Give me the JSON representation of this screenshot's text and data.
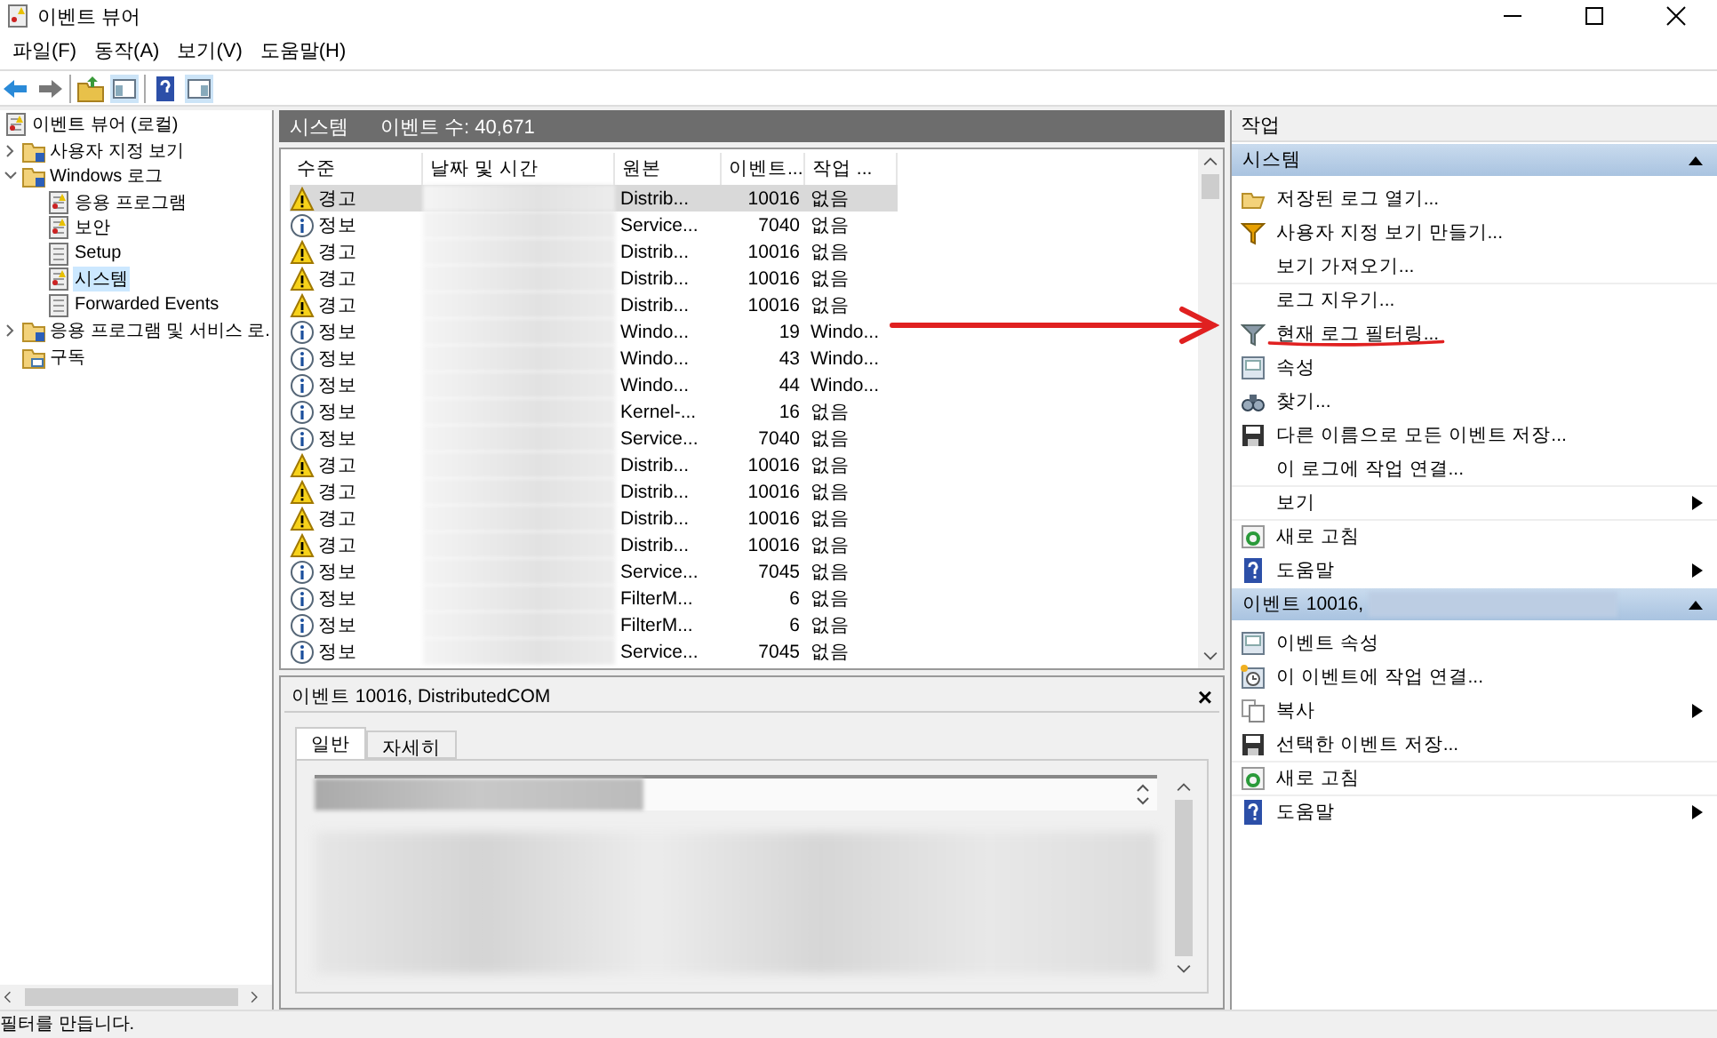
{
  "window": {
    "title": "이벤트 뷰어"
  },
  "menu": [
    "파일(F)",
    "동작(A)",
    "보기(V)",
    "도움말(H)"
  ],
  "tree": [
    {
      "label": "이벤트 뷰어 (로컬)",
      "kind": "root",
      "selected": false,
      "children": [
        {
          "label": "사용자 지정 보기",
          "kind": "folder",
          "selected": false,
          "expanded": false
        },
        {
          "label": "Windows 로그",
          "kind": "folder",
          "selected": false,
          "expanded": true,
          "children": [
            {
              "label": "응용 프로그램",
              "kind": "log",
              "selected": false
            },
            {
              "label": "보안",
              "kind": "log",
              "selected": false
            },
            {
              "label": "Setup",
              "kind": "plain",
              "selected": false
            },
            {
              "label": "시스템",
              "kind": "log",
              "selected": true
            },
            {
              "label": "Forwarded Events",
              "kind": "plain",
              "selected": false
            }
          ]
        },
        {
          "label": "응용 프로그램 및 서비스 로.",
          "kind": "folder",
          "selected": false,
          "expanded": false
        },
        {
          "label": "구독",
          "kind": "subscription",
          "selected": false
        }
      ]
    }
  ],
  "list": {
    "title": "시스템",
    "count": "이벤트 수: 40,671",
    "columns": [
      "수준",
      "날짜 및 시간",
      "원본",
      "이벤트...",
      "작업 ..."
    ],
    "rows": [
      {
        "kind": "warning",
        "level": "경고",
        "source": "Distrib...",
        "id": "10016",
        "category": "없음",
        "selected": true
      },
      {
        "kind": "info",
        "level": "정보",
        "source": "Service...",
        "id": "7040",
        "category": "없음",
        "selected": false
      },
      {
        "kind": "warning",
        "level": "경고",
        "source": "Distrib...",
        "id": "10016",
        "category": "없음",
        "selected": false
      },
      {
        "kind": "warning",
        "level": "경고",
        "source": "Distrib...",
        "id": "10016",
        "category": "없음",
        "selected": false
      },
      {
        "kind": "warning",
        "level": "경고",
        "source": "Distrib...",
        "id": "10016",
        "category": "없음",
        "selected": false
      },
      {
        "kind": "info",
        "level": "정보",
        "source": "Windo...",
        "id": "19",
        "category": "Windo...",
        "selected": false
      },
      {
        "kind": "info",
        "level": "정보",
        "source": "Windo...",
        "id": "43",
        "category": "Windo...",
        "selected": false
      },
      {
        "kind": "info",
        "level": "정보",
        "source": "Windo...",
        "id": "44",
        "category": "Windo...",
        "selected": false
      },
      {
        "kind": "info",
        "level": "정보",
        "source": "Kernel-...",
        "id": "16",
        "category": "없음",
        "selected": false
      },
      {
        "kind": "info",
        "level": "정보",
        "source": "Service...",
        "id": "7040",
        "category": "없음",
        "selected": false
      },
      {
        "kind": "warning",
        "level": "경고",
        "source": "Distrib...",
        "id": "10016",
        "category": "없음",
        "selected": false
      },
      {
        "kind": "warning",
        "level": "경고",
        "source": "Distrib...",
        "id": "10016",
        "category": "없음",
        "selected": false
      },
      {
        "kind": "warning",
        "level": "경고",
        "source": "Distrib...",
        "id": "10016",
        "category": "없음",
        "selected": false
      },
      {
        "kind": "warning",
        "level": "경고",
        "source": "Distrib...",
        "id": "10016",
        "category": "없음",
        "selected": false
      },
      {
        "kind": "info",
        "level": "정보",
        "source": "Service...",
        "id": "7045",
        "category": "없음",
        "selected": false
      },
      {
        "kind": "info",
        "level": "정보",
        "source": "FilterM...",
        "id": "6",
        "category": "없음",
        "selected": false
      },
      {
        "kind": "info",
        "level": "정보",
        "source": "FilterM...",
        "id": "6",
        "category": "없음",
        "selected": false
      },
      {
        "kind": "info",
        "level": "정보",
        "source": "Service...",
        "id": "7045",
        "category": "없음",
        "selected": false
      }
    ]
  },
  "details": {
    "title": "이벤트 10016, DistributedCOM",
    "close": "×",
    "tabs": [
      {
        "label": "일반",
        "selected": true
      },
      {
        "label": "자세히",
        "selected": false
      }
    ]
  },
  "actions": {
    "title": "작업",
    "sections": [
      {
        "title": "시스템",
        "items": [
          {
            "label": "저장된 로그 열기...",
            "kind": "open",
            "submenu": false,
            "divider": false
          },
          {
            "label": "사용자 지정 보기 만들기...",
            "kind": "filter",
            "submenu": false,
            "divider": false
          },
          {
            "label": "보기 가져오기...",
            "kind": "none",
            "submenu": false,
            "divider": false
          },
          {
            "label": "로그 지우기...",
            "kind": "none",
            "submenu": false,
            "divider": true
          },
          {
            "label": "현재 로그 필터링...",
            "kind": "filter-grey",
            "submenu": false,
            "divider": false
          },
          {
            "label": "속성",
            "kind": "properties",
            "submenu": false,
            "divider": false
          },
          {
            "label": "찾기...",
            "kind": "find",
            "submenu": false,
            "divider": false
          },
          {
            "label": "다른 이름으로 모든 이벤트 저장...",
            "kind": "save",
            "submenu": false,
            "divider": false
          },
          {
            "label": "이 로그에 작업 연결...",
            "kind": "none",
            "submenu": false,
            "divider": false
          },
          {
            "label": "보기",
            "kind": "none",
            "submenu": true,
            "divider": true
          },
          {
            "label": "새로 고침",
            "kind": "refresh",
            "submenu": false,
            "divider": true
          },
          {
            "label": "도움말",
            "kind": "help",
            "submenu": true,
            "divider": false
          }
        ]
      },
      {
        "title": "이벤트 10016,",
        "items": [
          {
            "label": "이벤트 속성",
            "kind": "properties",
            "submenu": false,
            "divider": false
          },
          {
            "label": "이 이벤트에 작업 연결...",
            "kind": "task",
            "submenu": false,
            "divider": false
          },
          {
            "label": "복사",
            "kind": "copy",
            "submenu": true,
            "divider": false
          },
          {
            "label": "선택한 이벤트 저장...",
            "kind": "save",
            "submenu": false,
            "divider": false
          },
          {
            "label": "새로 고침",
            "kind": "refresh",
            "submenu": false,
            "divider": true
          },
          {
            "label": "도움말",
            "kind": "help",
            "submenu": true,
            "divider": true
          }
        ]
      }
    ]
  },
  "status_bar": "필터를 만듭니다."
}
